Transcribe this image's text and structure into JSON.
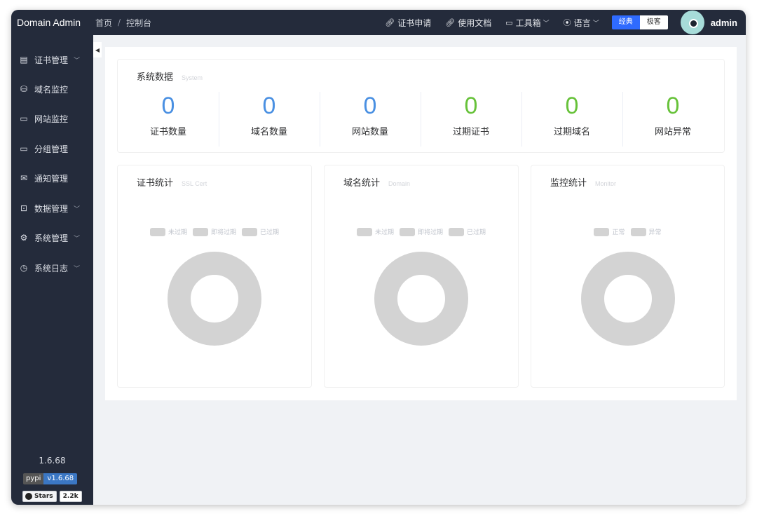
{
  "app": {
    "title": "Domain Admin",
    "username": "admin"
  },
  "breadcrumb": {
    "home": "首页",
    "separator": "/",
    "current": "控制台"
  },
  "topnav": {
    "cert_apply": "证书申请",
    "docs": "使用文档",
    "toolbox": "工具箱",
    "language": "语言",
    "theme_classic": "经典",
    "theme_geek": "极客"
  },
  "sidebar": {
    "items": [
      {
        "label": "证书管理",
        "icon": "doc-icon",
        "has_children": true
      },
      {
        "label": "域名监控",
        "icon": "database-icon",
        "has_children": false
      },
      {
        "label": "网站监控",
        "icon": "monitor-icon",
        "has_children": false
      },
      {
        "label": "分组管理",
        "icon": "folder-icon",
        "has_children": false
      },
      {
        "label": "通知管理",
        "icon": "mail-icon",
        "has_children": false
      },
      {
        "label": "数据管理",
        "icon": "box-icon",
        "has_children": true
      },
      {
        "label": "系统管理",
        "icon": "gear-icon",
        "has_children": true
      },
      {
        "label": "系统日志",
        "icon": "clock-icon",
        "has_children": true
      }
    ],
    "version": "1.6.68",
    "pypi_label": "pypi",
    "pypi_version": "v1.6.68",
    "github_stars_label": "Stars",
    "github_stars_count": "2.2k"
  },
  "system_data": {
    "title": "系统数据",
    "subtitle": "System",
    "stats": [
      {
        "label": "证书数量",
        "value": "0",
        "color": "#4a90e2"
      },
      {
        "label": "域名数量",
        "value": "0",
        "color": "#4a90e2"
      },
      {
        "label": "网站数量",
        "value": "0",
        "color": "#4a90e2"
      },
      {
        "label": "过期证书",
        "value": "0",
        "color": "#67c23a"
      },
      {
        "label": "过期域名",
        "value": "0",
        "color": "#67c23a"
      },
      {
        "label": "网站异常",
        "value": "0",
        "color": "#67c23a"
      }
    ]
  },
  "charts": [
    {
      "title": "证书统计",
      "subtitle": "SSL Cert",
      "legend": [
        "未过期",
        "即将过期",
        "已过期"
      ]
    },
    {
      "title": "域名统计",
      "subtitle": "Domain",
      "legend": [
        "未过期",
        "即将过期",
        "已过期"
      ]
    },
    {
      "title": "监控统计",
      "subtitle": "Monitor",
      "legend": [
        "正常",
        "异常"
      ]
    }
  ],
  "chart_data": [
    {
      "type": "pie",
      "title": "证书统计",
      "categories": [
        "未过期",
        "即将过期",
        "已过期"
      ],
      "values": [
        0,
        0,
        0
      ],
      "empty_color": "#d3d3d3"
    },
    {
      "type": "pie",
      "title": "域名统计",
      "categories": [
        "未过期",
        "即将过期",
        "已过期"
      ],
      "values": [
        0,
        0,
        0
      ],
      "empty_color": "#d3d3d3"
    },
    {
      "type": "pie",
      "title": "监控统计",
      "categories": [
        "正常",
        "异常"
      ],
      "values": [
        0,
        0
      ],
      "empty_color": "#d3d3d3"
    }
  ]
}
